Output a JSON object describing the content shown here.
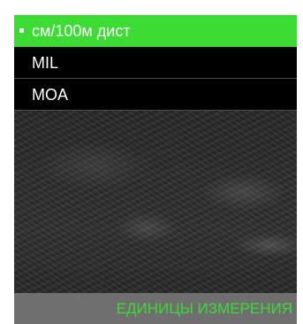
{
  "menu": {
    "items": [
      {
        "label": "см/100м дист",
        "selected": true
      },
      {
        "label": "MIL",
        "selected": false
      },
      {
        "label": "MOA",
        "selected": false
      }
    ]
  },
  "footer": {
    "title": "ЕДИНИЦЫ ИЗМЕРЕНИЯ"
  },
  "colors": {
    "accent": "#3ddc34",
    "footer_bg": "#6f6f6f",
    "menu_bg": "#000000"
  }
}
